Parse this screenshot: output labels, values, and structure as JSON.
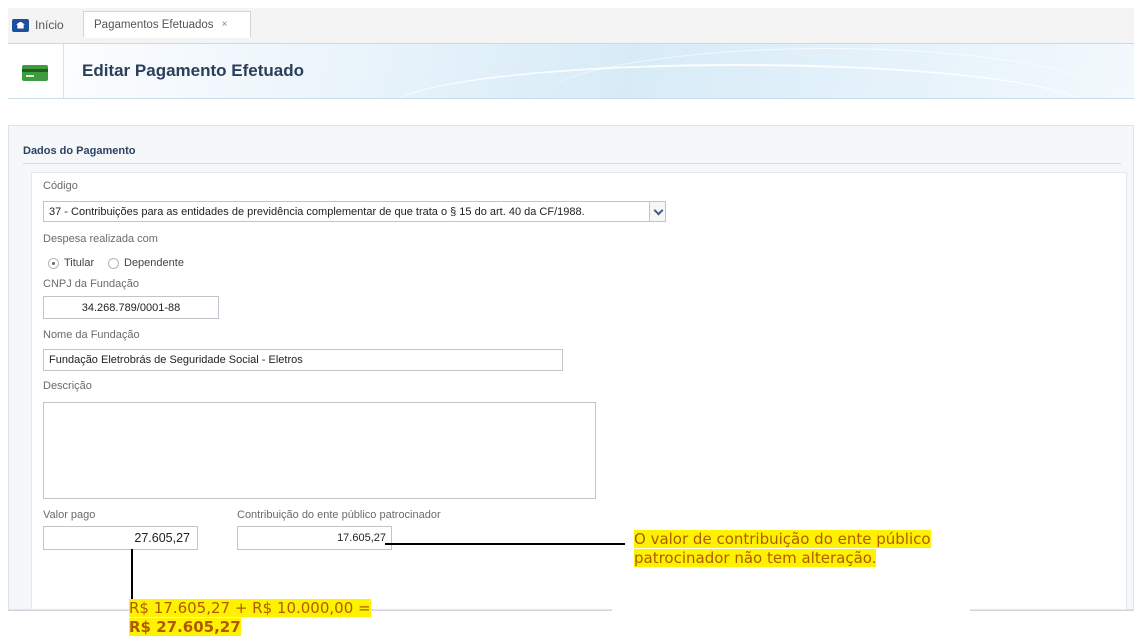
{
  "tabs": {
    "home_label": "Início",
    "active_label": "Pagamentos Efetuados",
    "close_glyph": "×"
  },
  "header": {
    "title": "Editar Pagamento Efetuado",
    "icon": "credit-card-icon"
  },
  "form": {
    "section_title": "Dados do Pagamento",
    "codigo": {
      "label": "Código",
      "selected": "37 - Contribuições para as entidades de previdência complementar de que trata o § 15 do art. 40 da CF/1988."
    },
    "despesa": {
      "label": "Despesa realizada com",
      "options": [
        "Titular",
        "Dependente"
      ],
      "selected": "Titular"
    },
    "cnpj": {
      "label": "CNPJ da Fundação",
      "value": "34.268.789/0001-88"
    },
    "nome_fundacao": {
      "label": "Nome da Fundação",
      "value": "Fundação Eletrobrás de Seguridade Social - Eletros"
    },
    "descricao": {
      "label": "Descrição",
      "value": ""
    },
    "valor_pago": {
      "label": "Valor pago",
      "value": "27.605,27"
    },
    "contribuicao": {
      "label": "Contribuição do ente público patrocinador",
      "value": "17.605,27"
    }
  },
  "annotations": {
    "right_note": "O valor de contribuição do ente público patrocinador não tem alteração.",
    "bottom_note_line1": "R$ 17.605,27 + R$ 10.000,00 =",
    "bottom_note_line2": "R$ 27.605,27",
    "highlight_color": "#fff200",
    "text_color": "#b05a00"
  }
}
